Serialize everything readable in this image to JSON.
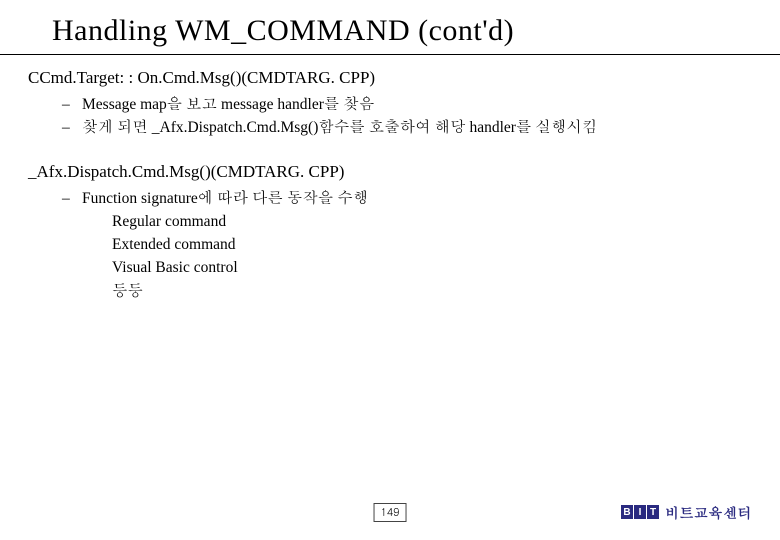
{
  "title": "Handling WM_COMMAND (cont'd)",
  "sections": [
    {
      "heading": "CCmd.Target: : On.Cmd.Msg()(CMDTARG. CPP)",
      "bullets": [
        "Message map을 보고 message handler를 찾음",
        "찾게 되면 _Afx.Dispatch.Cmd.Msg()함수를 호출하여 해당 handler를 실행시킴"
      ],
      "subitems": []
    },
    {
      "heading": "_Afx.Dispatch.Cmd.Msg()(CMDTARG. CPP)",
      "bullets": [
        "Function signature에 따라 다른 동작을 수행"
      ],
      "subitems": [
        "Regular command",
        "Extended command",
        "Visual Basic control",
        "등등"
      ]
    }
  ],
  "footer": {
    "page": "149",
    "logo": {
      "b": "B",
      "i": "I",
      "t": "T"
    },
    "brand_text": "비트교육센터"
  }
}
